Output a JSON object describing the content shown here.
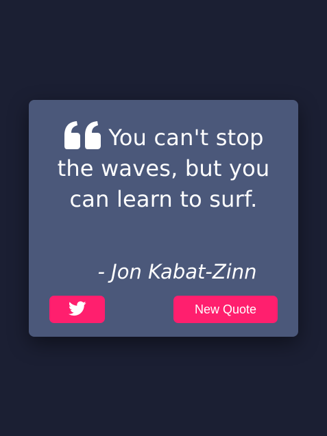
{
  "quote": {
    "text": "You can't stop the waves, but you can learn to surf.",
    "author": "- Jon Kabat-Zinn",
    "icon": "quote-left-icon"
  },
  "actions": {
    "tweet_icon": "twitter-icon",
    "new_quote_label": "New Quote"
  },
  "colors": {
    "background": "#1b1f33",
    "card": "#4b587a",
    "accent": "#ff1f6e",
    "text": "#ffffff"
  }
}
